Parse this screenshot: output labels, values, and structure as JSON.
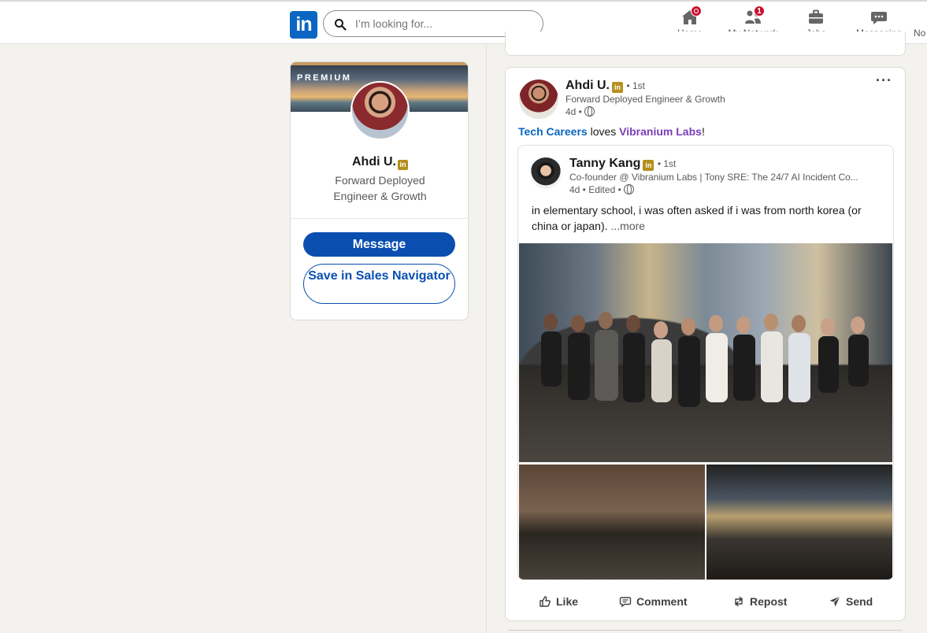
{
  "nav": {
    "logo_text": "in",
    "search_placeholder": "I’m looking for...",
    "items": [
      {
        "label": "Home",
        "badge": ""
      },
      {
        "label": "My Network",
        "badge": "1"
      },
      {
        "label": "Jobs",
        "badge": ""
      },
      {
        "label": "Messaging",
        "badge": ""
      }
    ],
    "cut_label": "No"
  },
  "profile": {
    "banner_label": "PREMIUM",
    "name": "Ahdi U.",
    "headline": "Forward Deployed Engineer & Growth",
    "message_label": "Message",
    "save_label": "Save in Sales Navigator"
  },
  "post": {
    "author": "Ahdi U.",
    "degree": "• 1st",
    "headline": "Forward Deployed Engineer & Growth",
    "time": "4d •",
    "activity": {
      "actor": "Tech Careers",
      "verb": " loves ",
      "target": "Vibranium Labs",
      "end": "!"
    },
    "reshared": {
      "author": "Tanny Kang",
      "degree": "• 1st",
      "headline": "Co-founder @ Vibranium Labs | Tony SRE: The 24/7 AI Incident Co...",
      "time": "4d • Edited •",
      "text": "in elementary school, i was often asked if i was from north korea (or china or japan).",
      "see_more": "...more"
    },
    "actions": {
      "like": "Like",
      "comment": "Comment",
      "repost": "Repost",
      "send": "Send"
    }
  },
  "colors": {
    "brand": "#0a66c2",
    "badge": "#cb112d",
    "premium_gold": "#b58f1c"
  }
}
